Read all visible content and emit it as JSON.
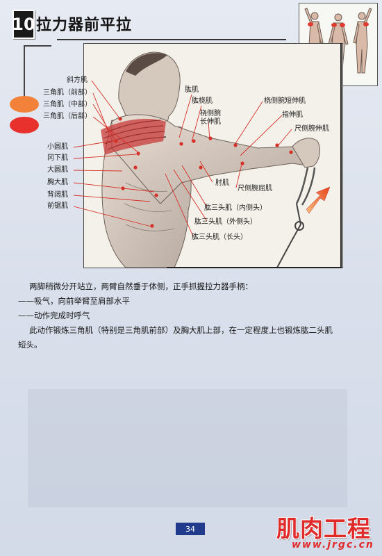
{
  "header": {
    "chapter_number": "10",
    "title": "拉力器前平拉"
  },
  "labels": {
    "trapezius": "斜方肌",
    "deltoid_anterior": "三角肌（前部）",
    "deltoid_middle": "三角肌（中部）",
    "deltoid_posterior": "三角肌（后部）",
    "teres_minor": "小圆肌",
    "infraspinatus": "冈下肌",
    "teres_major": "大圆肌",
    "pectoralis_major": "胸大肌",
    "latissimus": "背阔肌",
    "serratus": "前锯肌",
    "brachialis": "肱肌",
    "brachioradialis": "肱桡肌",
    "ecrl_line1": "桡侧腕",
    "ecrl_line2": "长伸肌",
    "ecrb": "桡侧腕短伸肌",
    "extensor_digitorum": "指伸肌",
    "ecu": "尺侧腕伸肌",
    "fcu": "尺侧腕屈肌",
    "anconeus": "肘肌",
    "triceps_medial": "肱三头肌（内侧头）",
    "triceps_lateral": "肱三头肌（外侧头）",
    "triceps_long": "肱三头肌（长头）"
  },
  "body": {
    "line1": "两脚稍微分开站立，两臂自然垂于体侧，正手抓握拉力器手柄：",
    "line2": "——吸气，向前举臂至肩部水平",
    "line3": "——动作完成时呼气",
    "line4": "此动作锻炼三角肌（特别是三角肌前部）及胸大肌上部，在一定程度上也锻炼肱二头肌",
    "line5": "短头。"
  },
  "footer": {
    "page_number": "34",
    "brand": "肌肉工程",
    "url": "www.jrgc.cn"
  },
  "colors": {
    "legend_orange": "#f2823a",
    "legend_red": "#e8312c",
    "brand_red": "#e02b2b",
    "page_badge": "#223a8c"
  }
}
